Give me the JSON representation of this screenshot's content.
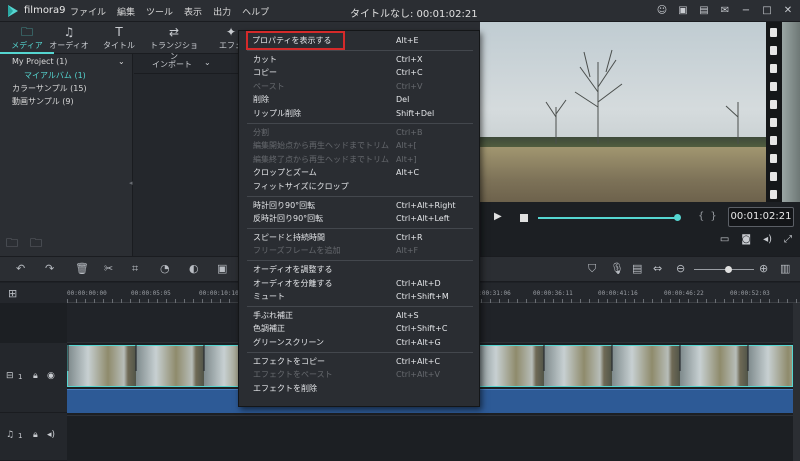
{
  "app": {
    "name": "filmora9",
    "window_title": "タイトルなし: 00:01:02:21",
    "menu": [
      "ファイル",
      "編集",
      "ツール",
      "表示",
      "出力",
      "ヘルプ"
    ]
  },
  "tabs": [
    "メディア",
    "オーディオ",
    "タイトル",
    "トランジション",
    "エフェ"
  ],
  "media_tree": {
    "items": [
      "My Project (1)",
      "マイアルバム (1)",
      "カラーサンプル (15)",
      "動画サンプル (9)"
    ]
  },
  "import_bar": {
    "import_label": "インポート"
  },
  "preview": {
    "timecode": "00:01:02:21",
    "progress": 0.98
  },
  "ruler": {
    "ticks": [
      "00:00:00:00",
      "00:00:05:05",
      "00:00:10:10",
      "00:00:31:06",
      "00:00:36:11",
      "00:00:41:16",
      "00:00:46:22",
      "00:00:52:03"
    ]
  },
  "tracks": {
    "video_label": "1",
    "audio_label": "1"
  },
  "context_menu": {
    "groups": [
      [
        {
          "label": "プロパティを表示する",
          "shortcut": "Alt+E",
          "highlighted": true
        }
      ],
      [
        {
          "label": "カット",
          "shortcut": "Ctrl+X"
        },
        {
          "label": "コピー",
          "shortcut": "Ctrl+C"
        },
        {
          "label": "ペースト",
          "shortcut": "Ctrl+V",
          "disabled": true
        },
        {
          "label": "削除",
          "shortcut": "Del"
        },
        {
          "label": "リップル削除",
          "shortcut": "Shift+Del"
        }
      ],
      [
        {
          "label": "分割",
          "shortcut": "Ctrl+B",
          "disabled": true
        },
        {
          "label": "編集開始点から再生ヘッドまでトリム",
          "shortcut": "Alt+[",
          "disabled": true
        },
        {
          "label": "編集終了点から再生ヘッドまでトリム",
          "shortcut": "Alt+]",
          "disabled": true
        },
        {
          "label": "クロップとズーム",
          "shortcut": "Alt+C"
        },
        {
          "label": "フィットサイズにクロップ",
          "shortcut": ""
        }
      ],
      [
        {
          "label": "時計回り90°回転",
          "shortcut": "Ctrl+Alt+Right"
        },
        {
          "label": "反時計回り90°回転",
          "shortcut": "Ctrl+Alt+Left"
        }
      ],
      [
        {
          "label": "スピードと持続時間",
          "shortcut": "Ctrl+R"
        },
        {
          "label": "フリーズフレームを追加",
          "shortcut": "Alt+F",
          "disabled": true
        }
      ],
      [
        {
          "label": "オーディオを調整する",
          "shortcut": ""
        },
        {
          "label": "オーディオを分離する",
          "shortcut": "Ctrl+Alt+D"
        },
        {
          "label": "ミュート",
          "shortcut": "Ctrl+Shift+M"
        }
      ],
      [
        {
          "label": "手ぶれ補正",
          "shortcut": "Alt+S"
        },
        {
          "label": "色調補正",
          "shortcut": "Ctrl+Shift+C"
        },
        {
          "label": "グリーンスクリーン",
          "shortcut": "Ctrl+Alt+G"
        }
      ],
      [
        {
          "label": "エフェクトをコピー",
          "shortcut": "Ctrl+Alt+C"
        },
        {
          "label": "エフェクトをペースト",
          "shortcut": "Ctrl+Alt+V",
          "disabled": true
        },
        {
          "label": "エフェクトを削除",
          "shortcut": ""
        }
      ]
    ]
  },
  "colors": {
    "accent": "#55d6d1",
    "highlight_box": "#d42a2a",
    "audio_bar": "#2d5a96"
  }
}
